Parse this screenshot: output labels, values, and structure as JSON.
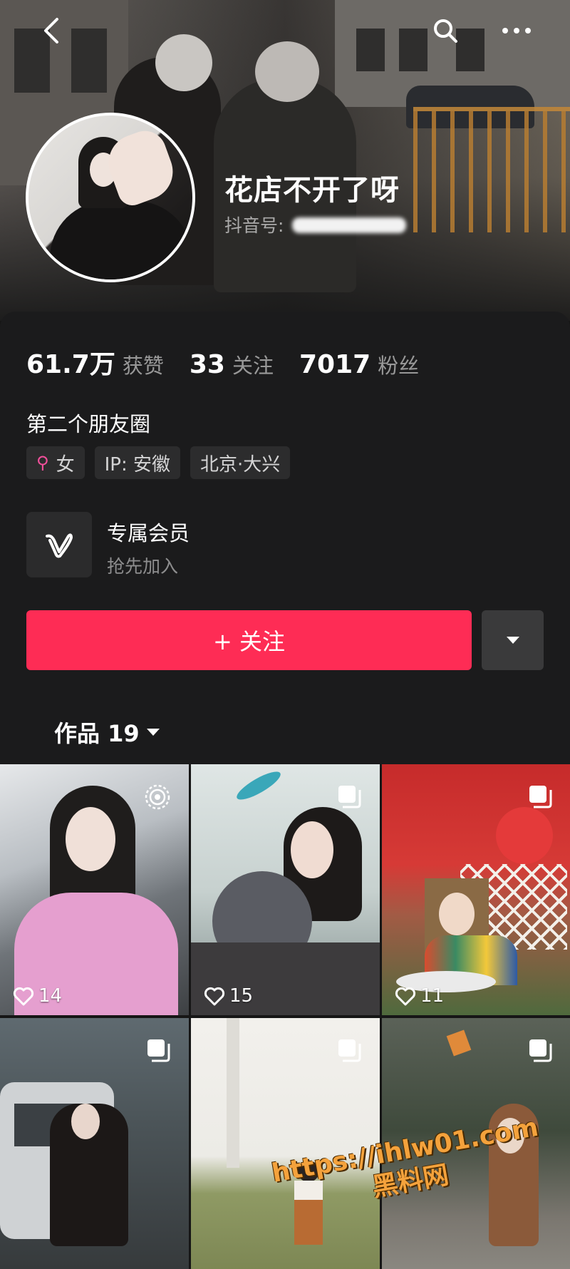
{
  "header": {
    "nickname": "花店不开了呀",
    "douyin_id_label": "抖音号:"
  },
  "stats": [
    {
      "value": "61.7万",
      "label": "获赞"
    },
    {
      "value": "33",
      "label": "关注"
    },
    {
      "value": "7017",
      "label": "粉丝"
    }
  ],
  "bio": "第二个朋友圈",
  "tags": [
    {
      "icon": "female-icon",
      "label": "女"
    },
    {
      "label": "IP: 安徽"
    },
    {
      "label": "北京·大兴"
    }
  ],
  "membership": {
    "title": "专属会员",
    "subtitle": "抢先加入"
  },
  "actions": {
    "follow_label": "+ 关注"
  },
  "works_tab": {
    "label": "作品 19"
  },
  "videos": [
    {
      "likes": "14",
      "badge": "live-icon"
    },
    {
      "likes": "15",
      "badge": "multi-image-icon"
    },
    {
      "likes": "11",
      "badge": "multi-image-icon"
    },
    {
      "likes": "",
      "badge": "multi-image-icon"
    },
    {
      "likes": "",
      "badge": "multi-image-icon"
    },
    {
      "likes": "",
      "badge": "multi-image-icon"
    }
  ],
  "watermark": {
    "line1": "https://ihlw01.com",
    "line2": "黑料网"
  },
  "colors": {
    "follow": "#fe2c55",
    "background": "#161616",
    "female": "#f24f9b"
  }
}
